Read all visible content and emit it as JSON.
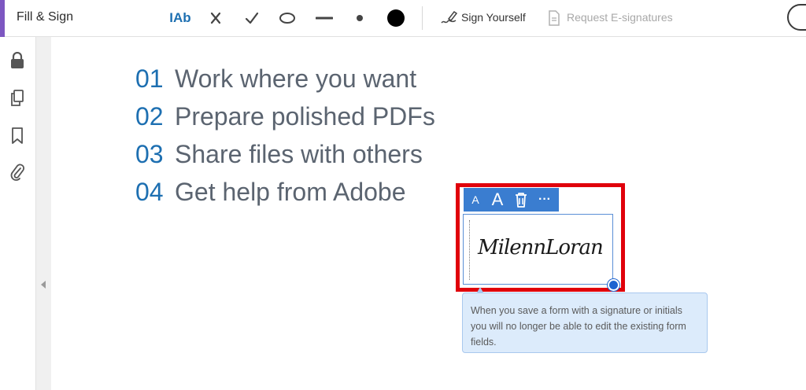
{
  "toolbar": {
    "title": "Fill & Sign",
    "tools": [
      {
        "name": "add-text-icon",
        "label": "IAb"
      },
      {
        "name": "cross-mark-icon"
      },
      {
        "name": "check-mark-icon"
      },
      {
        "name": "ellipse-icon"
      },
      {
        "name": "line-icon"
      },
      {
        "name": "dot-icon"
      },
      {
        "name": "color-swatch-icon",
        "color": "#000000"
      }
    ],
    "sign_yourself_label": "Sign Yourself",
    "request_esignatures_label": "Request E-signatures"
  },
  "left_rail": {
    "icons": [
      "lock-icon",
      "copy-pages-icon",
      "bookmark-icon",
      "attachment-icon"
    ]
  },
  "document": {
    "items": [
      {
        "number": "01",
        "text": "Work where you want"
      },
      {
        "number": "02",
        "text": "Prepare polished PDFs"
      },
      {
        "number": "03",
        "text": "Share files with others"
      },
      {
        "number": "04",
        "text": "Get help from Adobe"
      }
    ]
  },
  "signature": {
    "mini_toolbar": {
      "decrease_label": "A",
      "increase_label": "A",
      "more_label": "···"
    },
    "signature_text": "MilennLoran",
    "tooltip_text": "When you save a form with a signature or initials you will no longer be able to edit the existing form fields."
  },
  "colors": {
    "accent_blue": "#1d6fb1",
    "highlight_red": "#e0000b",
    "toolbar_blue": "#3a7dd0",
    "tooltip_bg": "#dcebfb"
  }
}
